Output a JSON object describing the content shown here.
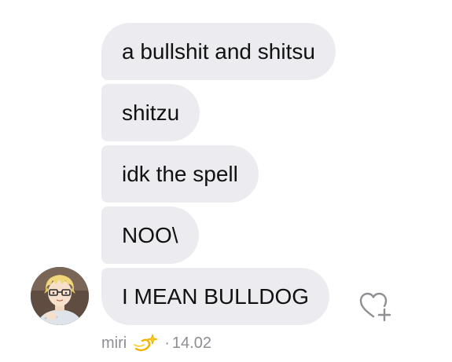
{
  "messages": [
    {
      "text": "a bullshit and shitsu"
    },
    {
      "text": "shitzu"
    },
    {
      "text": "idk the spell"
    },
    {
      "text": "NOO\\"
    },
    {
      "text": "I MEAN BULLDOG"
    }
  ],
  "sender": {
    "name": "miri",
    "badge_icon": "dizzy-sparkle-icon"
  },
  "meta": {
    "separator": "·",
    "time": "14.02"
  },
  "react_button": {
    "icon": "heart-plus-icon"
  },
  "colors": {
    "bubble_bg": "#ececf0",
    "text": "#111111",
    "meta_text": "#8d8d93",
    "icon_stroke": "#8e8e93"
  }
}
